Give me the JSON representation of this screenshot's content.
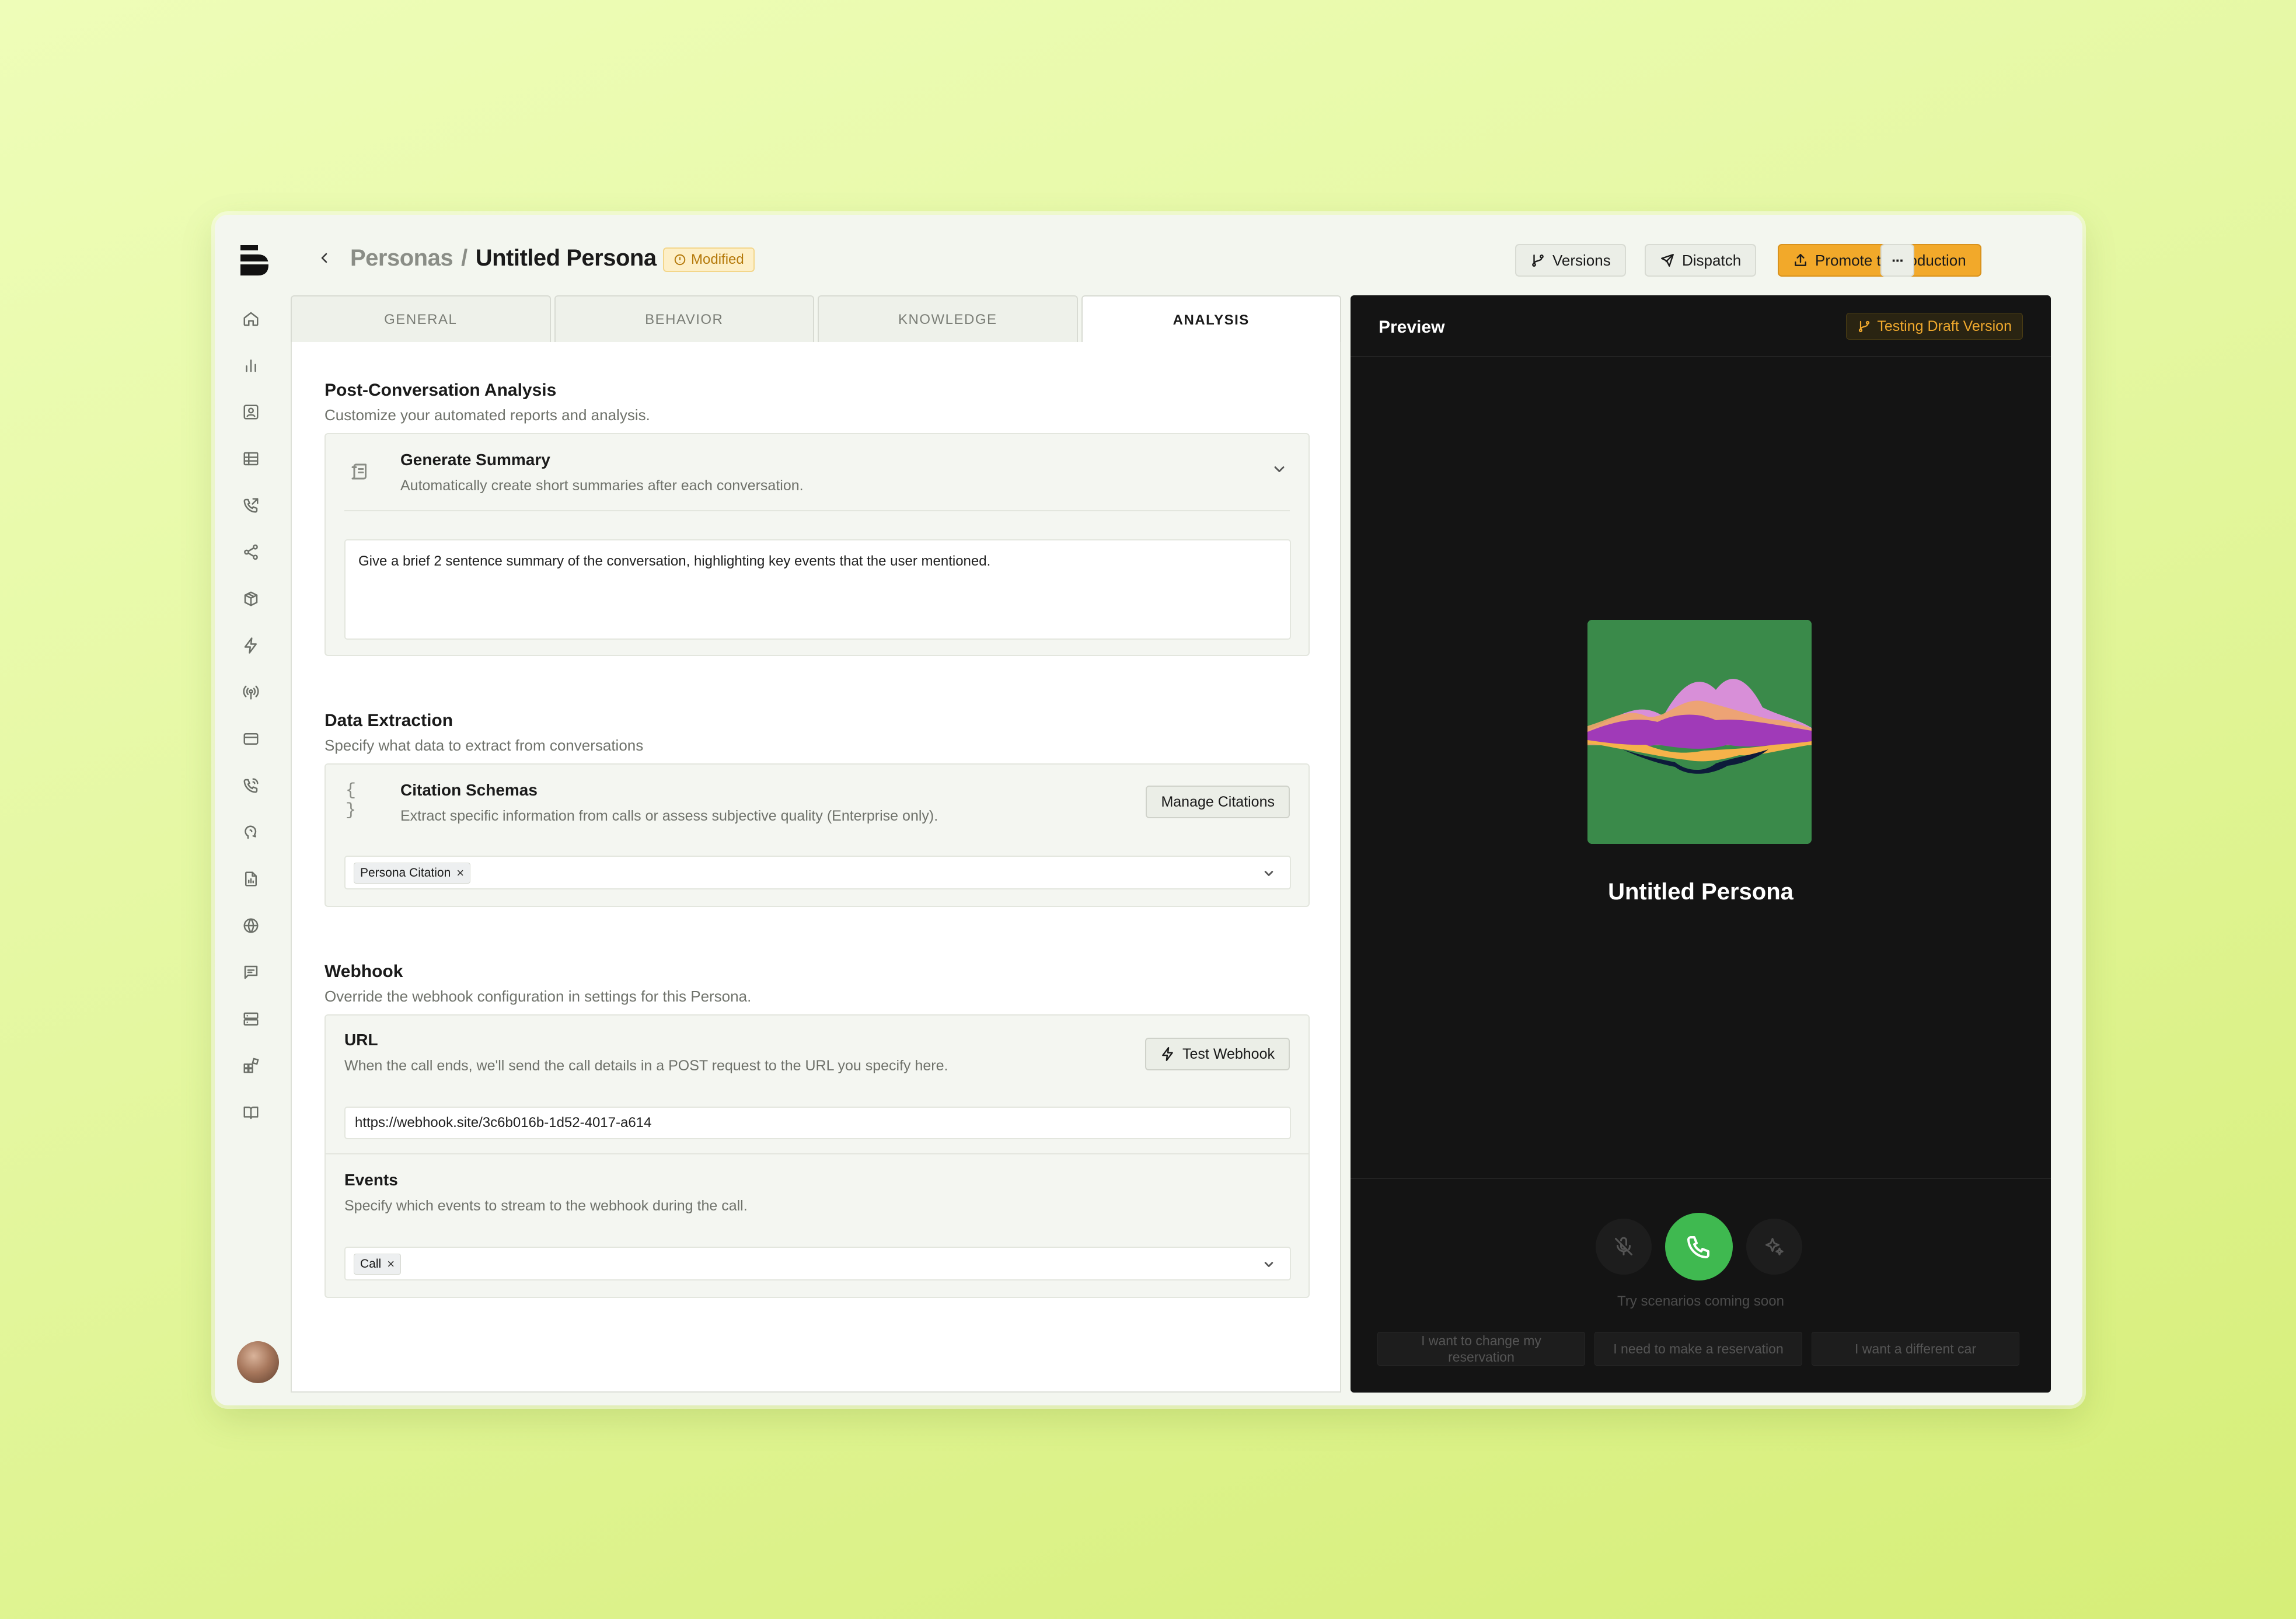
{
  "header": {
    "breadcrumb_parent": "Personas",
    "breadcrumb_sep": "/",
    "breadcrumb_current": "Untitled Persona",
    "status_badge": "Modified",
    "versions_label": "Versions",
    "dispatch_label": "Dispatch",
    "promote_label": "Promote to Production",
    "more_label": "···"
  },
  "sidebar": {
    "icons": [
      "home-icon",
      "bar-chart-icon",
      "contact-icon",
      "table-icon",
      "phone-outgoing-icon",
      "share-icon",
      "package-icon",
      "zap-icon",
      "radio-icon",
      "credit-card-icon",
      "phone-icon",
      "speech-icon",
      "file-chart-icon",
      "globe-icon",
      "message-icon",
      "server-icon",
      "blocks-icon",
      "book-icon"
    ]
  },
  "tabs": [
    {
      "label": "GENERAL",
      "active": false
    },
    {
      "label": "BEHAVIOR",
      "active": false
    },
    {
      "label": "KNOWLEDGE",
      "active": false
    },
    {
      "label": "ANALYSIS",
      "active": true
    }
  ],
  "analysis": {
    "title": "Post-Conversation Analysis",
    "subtitle": "Customize your automated reports and analysis.",
    "summary": {
      "title": "Generate Summary",
      "subtitle": "Automatically create short summaries after each conversation.",
      "prompt": "Give a brief 2 sentence summary of the conversation, highlighting key events that the user mentioned."
    }
  },
  "extraction": {
    "title": "Data Extraction",
    "subtitle": "Specify what data to extract from conversations",
    "citations": {
      "title": "Citation Schemas",
      "subtitle": "Extract specific information from calls or assess subjective quality (Enterprise only).",
      "button": "Manage Citations",
      "chip": "Persona Citation",
      "icon_text": "{ }"
    }
  },
  "webhook": {
    "title": "Webhook",
    "subtitle": "Override the webhook configuration in settings for this Persona.",
    "url_title": "URL",
    "url_subtitle": "When the call ends, we'll send the call details in a POST request to the URL you specify here.",
    "test_button": "Test Webhook",
    "url_value": "https://webhook.site/3c6b016b-1d52-4017-a614",
    "events_title": "Events",
    "events_subtitle": "Specify which events to stream to the webhook during the call.",
    "events_chip": "Call"
  },
  "preview": {
    "title": "Preview",
    "badge": "Testing Draft Version",
    "persona_name": "Untitled Persona",
    "scenarios_note": "Try scenarios coming soon",
    "scenarios": [
      "I want to change my reservation",
      "I need to make a reservation",
      "I want a different car"
    ]
  },
  "colors": {
    "accent": "#f2a92a",
    "call_green": "#3fb950",
    "preview_bg": "#141414"
  }
}
